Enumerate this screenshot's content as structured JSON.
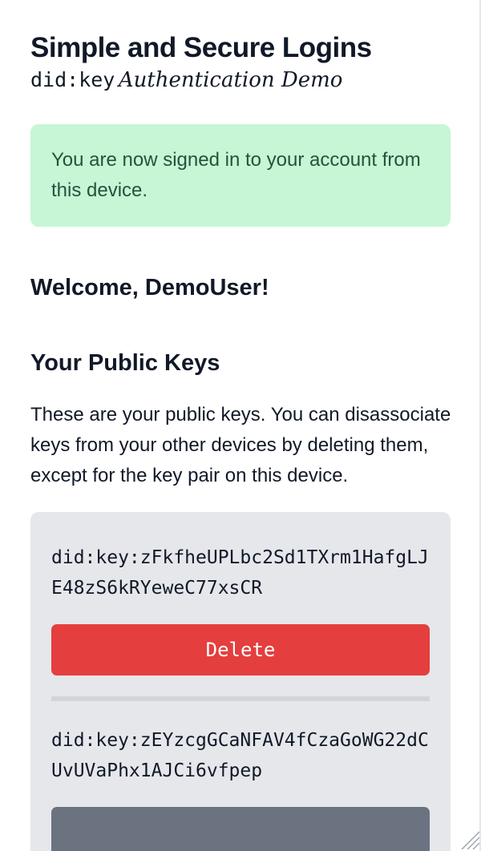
{
  "header": {
    "title": "Simple and Secure Logins",
    "subtitle_code": "did:key",
    "subtitle_text": "Authentication Demo"
  },
  "alert": {
    "message": "You are now signed in to your account from this device.",
    "color_bg": "#c6f6d5",
    "color_text": "#22543d"
  },
  "welcome": {
    "text": "Welcome, DemoUser!"
  },
  "keys": {
    "heading": "Your Public Keys",
    "description": "These are your public keys. You can disassociate keys from your other devices by deleting them, except for the key pair on this device.",
    "items": [
      {
        "id": "did:key:zFkfheUPLbc2Sd1TXrm1HafgLJE48zS6kRYeweC77xsCR",
        "action_label": "Delete"
      },
      {
        "id": "did:key:zEYzcgGCaNFAV4fCzaGoWG22dCUvUVaPhx1AJCi6vfpep"
      }
    ]
  },
  "colors": {
    "delete_button": "#e53e3e",
    "current_device_button": "#6b7280",
    "card_bg": "#e5e7eb"
  },
  "icons": {
    "resize_grip": "resize-grip-icon"
  }
}
